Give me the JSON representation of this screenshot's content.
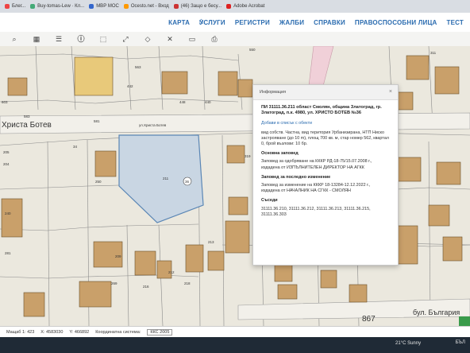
{
  "bookmarks": [
    {
      "label": "Блег..."
    },
    {
      "label": "Buy-tomas-Lew · Кл..."
    },
    {
      "label": "МВР МОС"
    },
    {
      "label": "Ocesto.net - Вход"
    },
    {
      "label": "(46) Защо е бесу..."
    },
    {
      "label": "Adobe Acrobat"
    }
  ],
  "nav": {
    "items": [
      "КАРТА",
      "УСЛУГИ",
      "РЕГИСТРИ",
      "ЖАЛБИ",
      "СПРАВКИ",
      "ПРАВОСПОСОБНИ ЛИЦА",
      "ТЕСТ"
    ]
  },
  "map": {
    "street_main": "Христа Ботев",
    "street_small": "ул.Христа Ботев",
    "street_bottom": "бул. България",
    "road_number": "867",
    "labels": [
      "581",
      "563",
      "442",
      "603",
      "448",
      "440",
      "583",
      "205",
      "204",
      "34",
      "250",
      "211",
      "36",
      "240",
      "281",
      "216",
      "212",
      "209",
      "213",
      "269",
      "218",
      "319",
      "550",
      "311"
    ]
  },
  "panel": {
    "title": "Информация",
    "close": "×",
    "id_line": "ПИ 31111.36.211 област Смолян, община Златоград, гр. Златоград, п.к. 4980, ул. ХРИСТО БОТЕВ №36",
    "add_link": "Добави в списък с обекти",
    "description": "вид собств. Частна, вид територия Урбанизирана, НТП Ниско застрояване (до 10 m), площ 700 кв. м, стар номер 562, квартал 0, брой възлови: 10 бр.",
    "base_title": "Основна заповед",
    "base_text": "Заповед за одобряване на КККР РД-18-75/15.07.2008 г., издадена от ИЗПЪЛНИТЕЛЕН ДИРЕКТОР НА АГКК",
    "last_title": "Заповед за последно изменение",
    "last_text": "Заповед за изменение на КККР 18-13284-12.12.2022 г., издадена от НАЧАЛНИК НА СГКК - СМОЛЯН",
    "neighbors_title": "Съседи",
    "neighbors": "31111.36.210, 31111.36.212, 31111.36.213, 31111.36.215, 31111.36.303"
  },
  "status": {
    "scale": "Мащаб 1: 423",
    "x": "X: 4583030",
    "y": "Y: 466892",
    "crs_label": "Координатна система:",
    "crs_value": "ККС 2005"
  },
  "taskbar": {
    "weather": "21°C Sunny",
    "lang": "БЪЛ"
  }
}
